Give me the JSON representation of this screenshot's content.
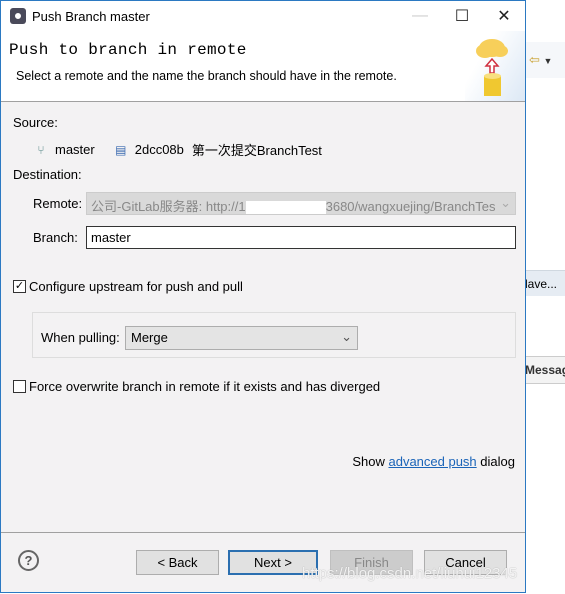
{
  "window": {
    "title": "Push Branch master",
    "minimize_icon": "minimize-icon",
    "maximize_icon": "maximize-icon",
    "close_icon": "close-icon"
  },
  "header": {
    "title": "Push to branch in remote",
    "description": "Select a remote and the name the branch should have in the remote."
  },
  "source": {
    "label": "Source:",
    "branch": "master",
    "commit_id": "2dcc08b",
    "commit_message": "第一次提交BranchTest"
  },
  "destination": {
    "label": "Destination:",
    "remote_label": "Remote:",
    "remote_value_prefix": "公司-GitLab服务器: http://1",
    "remote_value_suffix": "3680/wangxuejing/BranchTes",
    "branch_label": "Branch:",
    "branch_value": "master"
  },
  "upstream": {
    "label": "Configure upstream for push and pull",
    "checked": true,
    "when_pulling_label": "When pulling:",
    "when_pulling_value": "Merge"
  },
  "force": {
    "label": "Force overwrite branch in remote if it exists and has diverged",
    "checked": false
  },
  "advanced": {
    "prefix": "Show",
    "link": "advanced push",
    "suffix": "dialog"
  },
  "buttons": {
    "back": "< Back",
    "next": "Next >",
    "finish": "Finish",
    "cancel": "Cancel"
  },
  "background": {
    "save_button": "lave...",
    "messages_tab": "Messag"
  },
  "watermark": "https://blog.csdn.net/liuhui12345"
}
